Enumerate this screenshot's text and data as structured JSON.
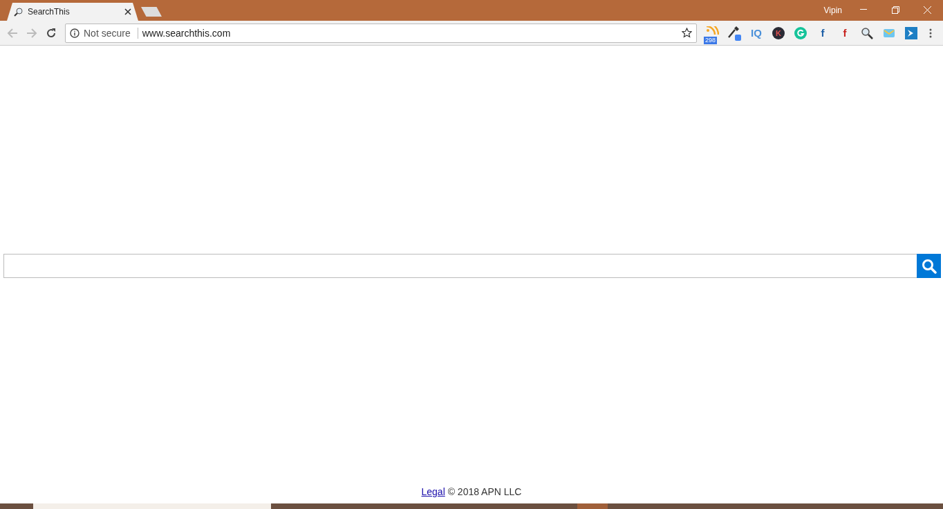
{
  "tab": {
    "title": "SearchThis",
    "selected": true
  },
  "window": {
    "user": "Vipin"
  },
  "toolbar": {
    "security": "Not secure",
    "url": "www.searchthis.com",
    "back_disabled": true,
    "forward_disabled": true
  },
  "extensions": [
    {
      "kind": "rss",
      "badge": "298"
    },
    {
      "kind": "dropper"
    },
    {
      "kind": "text",
      "text": "IQ",
      "color": "#4a90d9"
    },
    {
      "kind": "circle",
      "text": "K",
      "color": "#2b2b35"
    },
    {
      "kind": "grammar",
      "color": "#15c39a"
    },
    {
      "kind": "text",
      "text": "f",
      "color": "#1d5fa6"
    },
    {
      "kind": "text",
      "text": "f",
      "color": "#c8231f"
    },
    {
      "kind": "magnifier"
    },
    {
      "kind": "mail"
    },
    {
      "kind": "arrow"
    }
  ],
  "footer": {
    "link": "Legal",
    "text": "© 2018 APN LLC"
  }
}
